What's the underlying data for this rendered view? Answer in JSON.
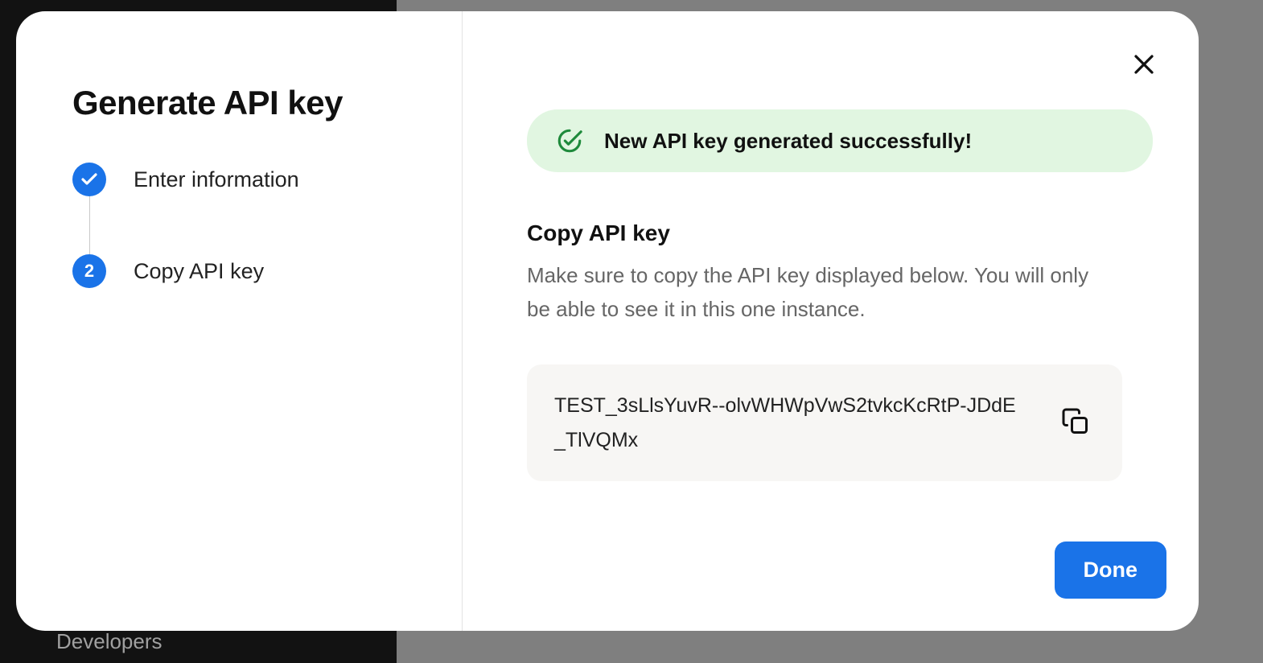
{
  "backdrop": {
    "bottom_text": "Developers"
  },
  "modal": {
    "title": "Generate API key",
    "steps": [
      {
        "label": "Enter information",
        "state": "done"
      },
      {
        "label": "Copy API key",
        "state": "current",
        "number": "2"
      }
    ],
    "success_message": "New API key generated successfully!",
    "section_heading": "Copy API key",
    "section_description": "Make sure to copy the API key displayed below. You will only be able to see it in this one instance.",
    "api_key": "TEST_3sLlsYuvR--olvWHWpVwS2tvkcKcRtP-JDdE_TlVQMx",
    "done_label": "Done"
  }
}
